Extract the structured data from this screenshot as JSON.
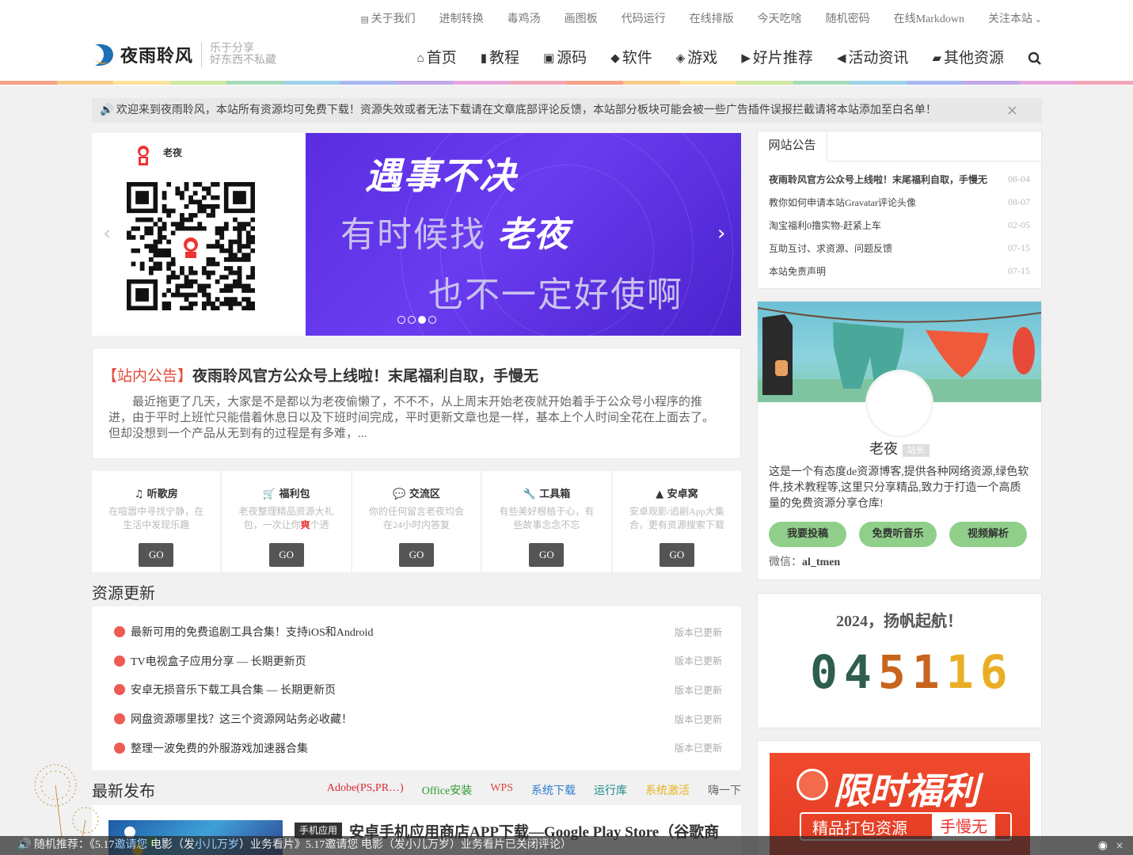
{
  "colors": {
    "accent": "#e44a3c",
    "banner": "#5a2de0",
    "button_green": "#8fcf8a",
    "rainbow": [
      "#f6a28a",
      "#f9c98b",
      "#fbe39a",
      "#cfe7a2",
      "#a7dbb8",
      "#9fd3e6",
      "#a9b8ef",
      "#c3a8ea",
      "#e5a8dc",
      "#f3a6b8",
      "#f6a28a",
      "#f9c98b",
      "#fbe39a",
      "#cfe7a2",
      "#a7dbb8",
      "#9fd3e6",
      "#a9b8ef",
      "#c3a8ea",
      "#e5a8dc",
      "#f3a6b8"
    ]
  },
  "topnav": [
    {
      "label": "关于我们",
      "icon": "info-square-icon"
    },
    {
      "label": "进制转换"
    },
    {
      "label": "毒鸡汤"
    },
    {
      "label": "画图板"
    },
    {
      "label": "代码运行"
    },
    {
      "label": "在线排版"
    },
    {
      "label": "今天吃啥"
    },
    {
      "label": "随机密码"
    },
    {
      "label": "在线Markdown"
    },
    {
      "label": "关注本站",
      "icon": "chevron-down-icon"
    }
  ],
  "logo": {
    "name": "夜雨聆风",
    "slogan1": "乐于分享",
    "slogan2": "好东西不私藏"
  },
  "mainnav": [
    {
      "label": "首页",
      "icon": "home-icon",
      "glyph": "⌂"
    },
    {
      "label": "教程",
      "icon": "bookmark-icon",
      "glyph": "▮"
    },
    {
      "label": "源码",
      "icon": "code-file-icon",
      "glyph": "▣"
    },
    {
      "label": "软件",
      "icon": "android-icon",
      "glyph": "◆"
    },
    {
      "label": "游戏",
      "icon": "gamepad-icon",
      "glyph": "◈"
    },
    {
      "label": "好片推荐",
      "icon": "play-circle-icon",
      "glyph": "▶"
    },
    {
      "label": "活动资讯",
      "icon": "bullhorn-icon",
      "glyph": "◀"
    },
    {
      "label": "其他资源",
      "icon": "folder-open-icon",
      "glyph": "▰"
    }
  ],
  "notice": {
    "text": "🔊 欢迎来到夜雨聆风，本站所有资源均可免费下载！资源失效或者无法下载请在文章底部评论反馈，本站部分板块可能会被一些广告插件误报拦截请将本站添加至白名单！",
    "close": "×"
  },
  "slider": {
    "qr_user": "老夜",
    "line1": "遇事不决",
    "line2": "有时候找",
    "line2_bold": "老夜",
    "line3": "也不一定好使啊",
    "prev": "‹",
    "next": "›",
    "active_dot": 2
  },
  "announcement": {
    "tag": "【站内公告】",
    "title": "夜雨聆风官方公众号上线啦！末尾福利自取，手慢无",
    "body": "最近拖更了几天，大家是不是都以为老夜偷懒了，不不不，从上周末开始老夜就开始着手于公众号小程序的推进，由于平时上班忙只能借着休息日以及下班时间完成，平时更新文章也是一样，基本上个人时间全花在上面去了。但却没想到一个产品从无到有的过程是有多难，..."
  },
  "cards": [
    {
      "title": "♫ 听歌房",
      "desc": "在喧嚣中寻找宁静，在生活中发现乐趣",
      "go": "GO"
    },
    {
      "title": "🛒 福利包",
      "desc_pre": "老夜整理精品资源大礼包，一次让你",
      "desc_hl": "爽",
      "desc_post": "个透",
      "go": "GO"
    },
    {
      "title": "💬 交流区",
      "desc": "你的任何留言老夜均会在24小时内答复",
      "go": "GO"
    },
    {
      "title": "🔧 工具箱",
      "desc": "有些美好根植于心，有些故事念念不忘",
      "go": "GO"
    },
    {
      "title": "▲ 安卓窝",
      "desc": "安卓观影/追剧App大集合，更有资源搜索下载",
      "go": "GO"
    }
  ],
  "updates": {
    "title": "资源更新",
    "items": [
      {
        "title": "最新可用的免费追剧工具合集！支持iOS和Android",
        "status": "版本已更新"
      },
      {
        "title": "TV电视盒子应用分享 — 长期更新页",
        "status": "版本已更新"
      },
      {
        "title": "安卓无损音乐下载工具合集 — 长期更新页",
        "status": "版本已更新"
      },
      {
        "title": "网盘资源哪里找？这三个资源网站务必收藏！",
        "status": "版本已更新"
      },
      {
        "title": "整理一波免费的外服游戏加速器合集",
        "status": "版本已更新"
      }
    ]
  },
  "latest": {
    "title": "最新发布",
    "cats": [
      {
        "label": "Adobe(PS,PR…)",
        "color": "#d9282f"
      },
      {
        "label": "Office安装",
        "color": "#2c9b2c"
      },
      {
        "label": "WPS",
        "color": "#e0443a"
      },
      {
        "label": "系统下载",
        "color": "#2b7fd0"
      },
      {
        "label": "运行库",
        "color": "#1d8a8a"
      },
      {
        "label": "系统激活",
        "color": "#e8b21e"
      },
      {
        "label": "嗨一下",
        "color": "#666666"
      }
    ],
    "post_tag": "手机应用",
    "post_title": "安卓手机应用商店APP下载—Google Play Store（谷歌商"
  },
  "sidebar": {
    "tab": "网站公告",
    "items": [
      {
        "title": "夜雨聆风官方公众号上线啦！末尾福利自取，手慢无",
        "date": "08-04"
      },
      {
        "title": "教你如何申请本站Gravatar评论头像",
        "date": "08-07"
      },
      {
        "title": "淘宝福利0撸实物-赶紧上车",
        "date": "02-05"
      },
      {
        "title": "互助互讨、求资源、问题反馈",
        "date": "07-15"
      },
      {
        "title": "本站免责声明",
        "date": "07-15"
      }
    ]
  },
  "profile": {
    "name": "老夜",
    "badge": "站长",
    "desc": "这是一个有态度de资源博客,提供各种网络资源,绿色软件,技术教程等,这里只分享精品,致力于打造一个高质量的免费资源分享仓库!",
    "buttons": [
      "我要投稿",
      "免费听音乐",
      "视频解析"
    ],
    "wx_label": "微信：",
    "wx_id": "al_tmen"
  },
  "counter": {
    "title": "2024，扬帆起航！",
    "digits": [
      {
        "d": "0",
        "color": "#2f5e4e"
      },
      {
        "d": "4",
        "color": "#2f5e4e"
      },
      {
        "d": "5",
        "color": "#c8641e"
      },
      {
        "d": "1",
        "color": "#c8641e"
      },
      {
        "d": "1",
        "color": "#e9ae25"
      },
      {
        "d": "6",
        "color": "#e9ae25"
      }
    ]
  },
  "promo": {
    "headline": "限时福利",
    "bar_a": "精品打包资源",
    "bar_b": "手慢无"
  },
  "ticker": {
    "label": "🔊 随机推荐：",
    "pre": "《5.17",
    "hl1": "邀请您",
    "mid1": "电影（发",
    "hl2": "小儿万岁",
    "mid2": "）业务看片》5.17邀请您 电影（发小儿万岁）业务看片已关闭评论）",
    "rss": "◉",
    "close": "×"
  }
}
